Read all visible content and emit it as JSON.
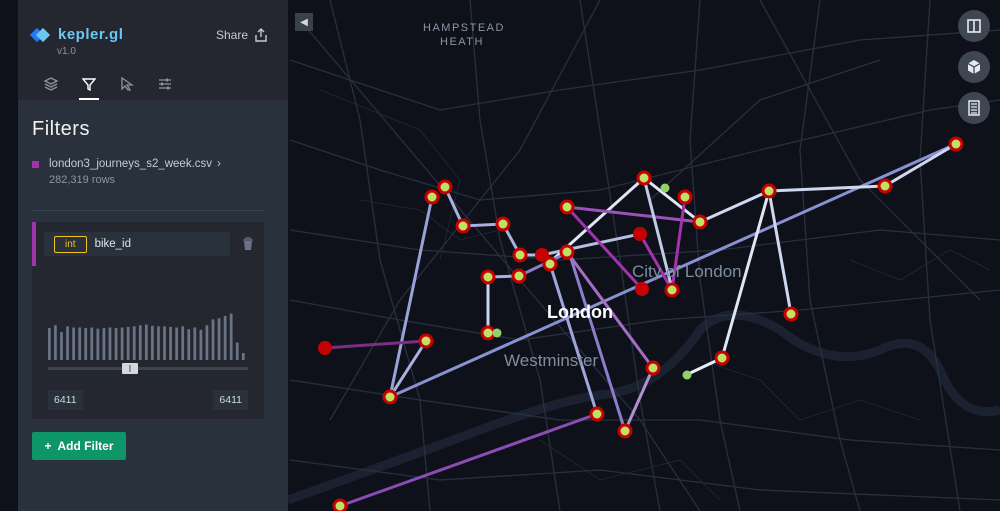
{
  "app": {
    "name": "kepler.gl",
    "version": "v1.0",
    "share_label": "Share"
  },
  "tabs": [
    {
      "name": "layers",
      "icon": "layers-icon"
    },
    {
      "name": "filters",
      "icon": "filter-icon",
      "active": true
    },
    {
      "name": "interactions",
      "icon": "cursor-icon"
    },
    {
      "name": "map-settings",
      "icon": "sliders-icon"
    }
  ],
  "panel": {
    "title": "Filters"
  },
  "dataset": {
    "name": "london3_journeys_s2_week.csv",
    "rows": "282,319 rows",
    "color": "#a133ad"
  },
  "filter": {
    "type": "int",
    "field": "bike_id",
    "range_min": "6411",
    "range_max": "6411",
    "handle_position": 0.41,
    "histogram": [
      0.55,
      0.6,
      0.48,
      0.58,
      0.56,
      0.56,
      0.55,
      0.56,
      0.54,
      0.55,
      0.56,
      0.55,
      0.56,
      0.57,
      0.58,
      0.6,
      0.61,
      0.59,
      0.58,
      0.58,
      0.57,
      0.56,
      0.58,
      0.53,
      0.56,
      0.52,
      0.6,
      0.7,
      0.72,
      0.76,
      0.8,
      0.3,
      0.12
    ]
  },
  "add_filter_label": "Add Filter",
  "map": {
    "labels": {
      "hampstead": "HAMPSTEAD",
      "heath": "HEATH",
      "city": "City of London",
      "london": "London",
      "westminster": "Westminster"
    }
  },
  "controls": [
    "split-map-icon",
    "3d-icon",
    "legend-icon"
  ],
  "colors": {
    "accent": "#6ec7f2",
    "filter": "#a133ad",
    "add": "#0f9668",
    "point": "#c2e065",
    "point_outline": "#c50101"
  }
}
